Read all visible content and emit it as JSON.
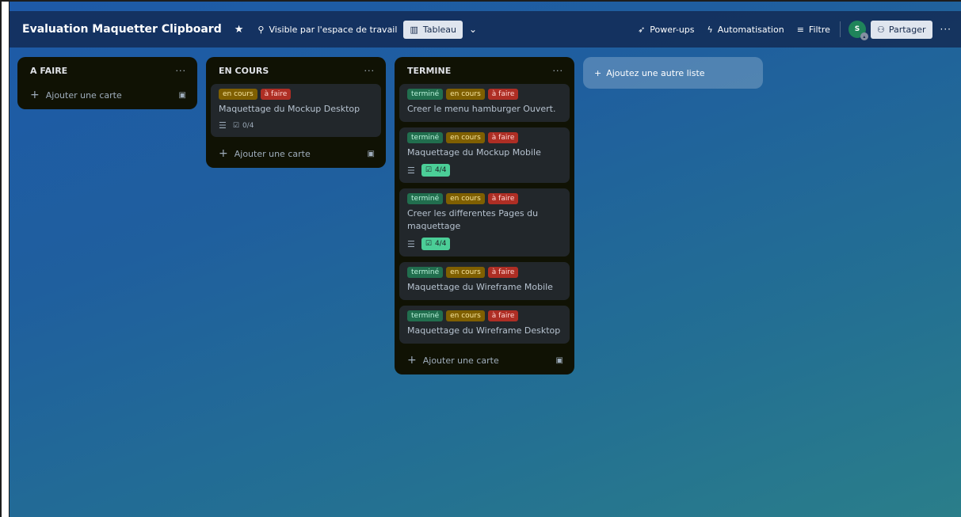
{
  "header": {
    "board_title": "Evaluation Maquetter Clipboard",
    "visibility": "Visible par l'espace de travail",
    "view": "Tableau",
    "powerups": "Power-ups",
    "automation": "Automatisation",
    "filter": "Filtre",
    "avatar_initial": "S",
    "share": "Partager"
  },
  "lists": [
    {
      "title": "A FAIRE",
      "add_card": "Ajouter une carte",
      "cards": []
    },
    {
      "title": "EN COURS",
      "add_card": "Ajouter une carte",
      "cards": [
        {
          "labels": [
            "en cours",
            "à faire"
          ],
          "title": "Maquettage du Mockup Desktop",
          "checklist": "0/4"
        }
      ]
    },
    {
      "title": "TERMINE",
      "add_card": "Ajouter une carte",
      "cards": [
        {
          "labels": [
            "terminé",
            "en cours",
            "à faire"
          ],
          "title": "Creer le menu hamburger Ouvert."
        },
        {
          "labels": [
            "terminé",
            "en cours",
            "à faire"
          ],
          "title": "Maquettage du Mockup Mobile",
          "checklist": "4/4"
        },
        {
          "labels": [
            "terminé",
            "en cours",
            "à faire"
          ],
          "title": "Creer les differentes Pages du maquettage",
          "checklist": "4/4"
        },
        {
          "labels": [
            "terminé",
            "en cours",
            "à faire"
          ],
          "title": "Maquettage du Wireframe Mobile"
        },
        {
          "labels": [
            "terminé",
            "en cours",
            "à faire"
          ],
          "title": "Maquettage du Wireframe Desktop"
        }
      ]
    }
  ],
  "add_list": "Ajoutez une autre liste",
  "colors": {
    "label_termine": "#216e4e",
    "label_encours": "#7f5f01",
    "label_afaire": "#ae2e24",
    "checklist_done": "#4bce97"
  }
}
